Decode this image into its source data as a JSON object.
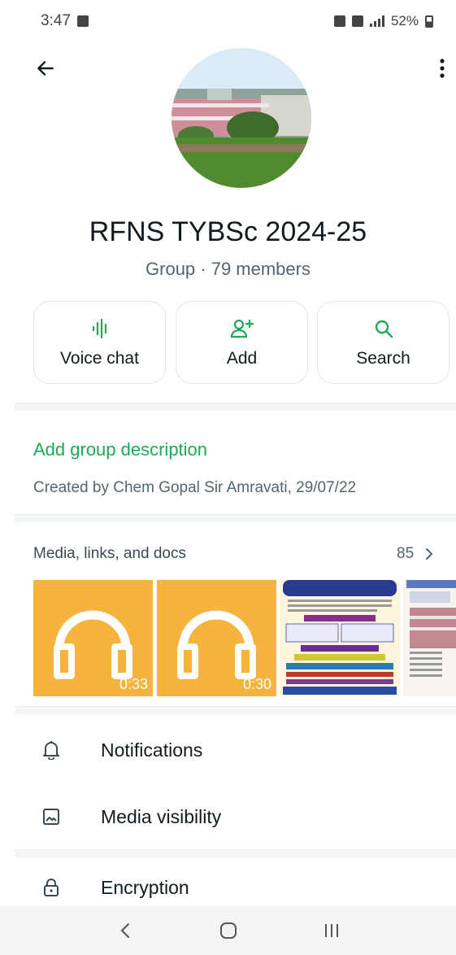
{
  "status_bar": {
    "time": "3:47",
    "battery": "52%"
  },
  "group": {
    "name": "RFNS TYBSc 2024-25",
    "subtitle": "Group · 79 members"
  },
  "actions": [
    {
      "label": "Voice chat",
      "icon": "voice-wave-icon"
    },
    {
      "label": "Add",
      "icon": "add-person-icon"
    },
    {
      "label": "Search",
      "icon": "search-icon"
    }
  ],
  "description": {
    "link": "Add group description",
    "created_by": "Created by Chem Gopal Sir Amravati, 29/07/22"
  },
  "media": {
    "header": "Media, links, and docs",
    "count": "85",
    "items": [
      {
        "type": "audio",
        "duration": "0:33"
      },
      {
        "type": "audio",
        "duration": "0:30"
      },
      {
        "type": "image",
        "caption": ""
      },
      {
        "type": "image",
        "caption": ""
      }
    ]
  },
  "list": [
    {
      "label": "Notifications",
      "icon": "bell-icon"
    },
    {
      "label": "Media visibility",
      "icon": "image-icon"
    },
    {
      "label": "Encryption",
      "icon": "lock-icon"
    }
  ],
  "colors": {
    "accent": "#1fa855",
    "audio_bg": "#f6b33d"
  }
}
